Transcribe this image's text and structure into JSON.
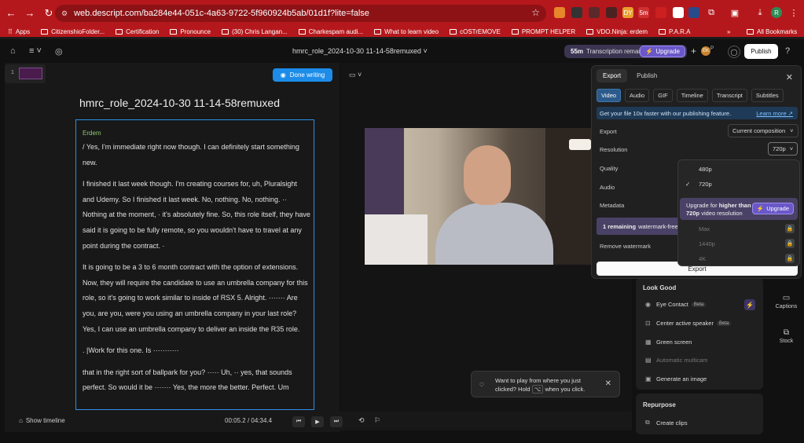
{
  "browser": {
    "url": "web.descript.com/ba284e44-051c-4a63-9722-5f960924b5ab/01d1f?lite=false",
    "bookmarks": [
      "Apps",
      "CitizenshioFolder...",
      "Certification",
      "Pronounce",
      "(30) Chris Langan...",
      "Charkespam audi...",
      "What to learn video",
      "cOSTrEMOVE",
      "PROMPT HELPER",
      "VDO.Ninja: erdem",
      "P.A.R.A"
    ],
    "all_bookmarks": "All Bookmarks",
    "ext_badges": [
      "DY",
      "5m"
    ],
    "avatar": "R"
  },
  "header": {
    "doc_title": "hmrc_role_2024-10-30 11-14-58remuxed",
    "transcription_minutes": "55m",
    "transcription_label": "Transcription remaining",
    "upgrade": "Upgrade",
    "publish": "Publish",
    "avatars": [
      "EK",
      "P"
    ]
  },
  "editor": {
    "scene_number": "1",
    "done_writing": "Done writing",
    "title": "hmrc_role_2024-10-30 11-14-58remuxed",
    "speaker": "Erdem",
    "paragraphs": [
      "/ Yes, I'm immediate right now though. I can definitely start something new.",
      "I finished it last week though. I'm creating courses for, uh, Pluralsight and Udemy. So I finished it last week. No, nothing. No, nothing. ·· Nothing at the moment, · it's absolutely fine. So, this role itself, they have said it is going to be fully remote, so you wouldn't have to travel at any point during the contract. ·",
      "It is going to be a 3 to 6 month contract with the option of extensions. Now, they will require the candidate to use an umbrella company for this role, so it's going to work similar to inside of RSX 5. Alright. ······· Are you, are you, were you using an umbrella company in your last role? Yes, I can use an umbrella company to deliver an inside the R35 role.",
      ". |Work for this one. Is ···········",
      "that in the right sort of ballpark for you? ····· Uh, ·· yes, that sounds perfect. So would it be ······· Yes, the more the better. Perfect. Um"
    ]
  },
  "playback": {
    "show_timeline": "Show timeline",
    "current": "00:05.2",
    "separator": "/",
    "total": "04:34.4"
  },
  "tooltip": {
    "line1": "Want to play from where you just",
    "line2a": "clicked? Hold",
    "key": "⌥",
    "line2b": "when you click."
  },
  "look_good": {
    "title": "Look Good",
    "items": [
      {
        "label": "Eye Contact",
        "beta": "Beta",
        "icon": "eye-icon"
      },
      {
        "label": "Center active speaker",
        "beta": "Beta",
        "icon": "center-icon"
      },
      {
        "label": "Green screen",
        "icon": "screen-icon"
      },
      {
        "label": "Automatic multicam",
        "icon": "multicam-icon",
        "disabled": true
      },
      {
        "label": "Generate an image",
        "icon": "image-icon"
      }
    ]
  },
  "repurpose": {
    "title": "Repurpose",
    "items": [
      {
        "label": "Create clips",
        "icon": "clip-icon"
      }
    ]
  },
  "rail": {
    "captions": "Captions",
    "stock": "Stock"
  },
  "export_panel": {
    "tabs": [
      "Export",
      "Publish"
    ],
    "formats": [
      "Video",
      "Audio",
      "GIF",
      "Timeline",
      "Transcript",
      "Subtitles"
    ],
    "info": "Get your file 10x faster with our publishing feature.",
    "learn_more": "Learn more ↗",
    "export_label": "Export",
    "export_value": "Current composition",
    "resolution_label": "Resolution",
    "resolution_value": "720p",
    "quality_label": "Quality",
    "audio_label": "Audio",
    "metadata_label": "Metadata",
    "watermark_count": "1 remaining",
    "watermark_text": "watermark-free",
    "remove_watermark": "Remove watermark",
    "export_button": "Export"
  },
  "resolution_dropdown": {
    "options": [
      {
        "label": "480p",
        "selected": false
      },
      {
        "label": "720p",
        "selected": true
      },
      {
        "label": "Max",
        "locked": true
      },
      {
        "label": "1440p",
        "locked": true
      },
      {
        "label": "4K",
        "locked": true
      }
    ],
    "upgrade_text_1": "Upgrade for ",
    "upgrade_text_bold": "higher than",
    "upgrade_text_2_bold": "720p",
    "upgrade_text_2": " video resolution",
    "upgrade_button": "Upgrade"
  },
  "colors": {
    "accent": "#1c8ce8",
    "brand_red": "#b5181c",
    "upgrade_purple": "#6a58c9"
  }
}
